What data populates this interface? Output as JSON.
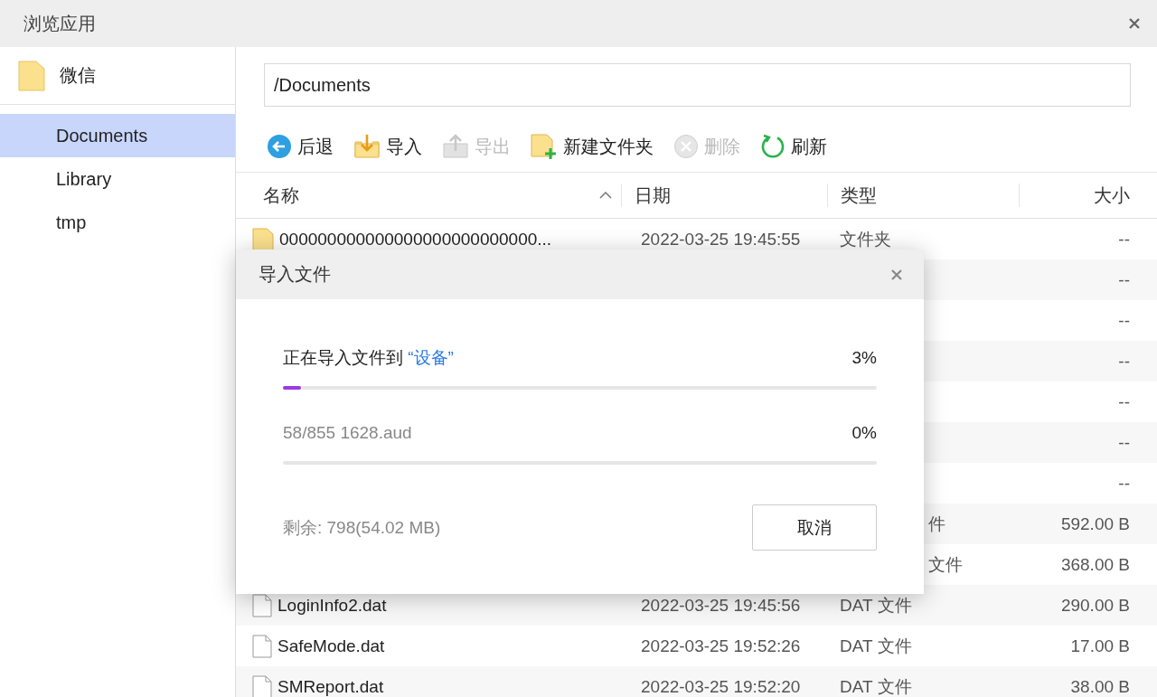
{
  "window": {
    "title": "浏览应用"
  },
  "sidebar": {
    "app": {
      "label": "微信"
    },
    "items": [
      {
        "label": "Documents",
        "selected": true
      },
      {
        "label": "Library",
        "selected": false
      },
      {
        "label": "tmp",
        "selected": false
      }
    ]
  },
  "path_field": {
    "value": "/Documents"
  },
  "toolbar": [
    {
      "kind": "back",
      "label": "后退",
      "disabled": false
    },
    {
      "kind": "import",
      "label": "导入",
      "disabled": false
    },
    {
      "kind": "export",
      "label": "导出",
      "disabled": true
    },
    {
      "kind": "new-folder",
      "label": "新建文件夹",
      "disabled": false
    },
    {
      "kind": "delete",
      "label": "删除",
      "disabled": true
    },
    {
      "kind": "refresh",
      "label": "刷新",
      "disabled": false
    }
  ],
  "table": {
    "columns": [
      {
        "label": "名称",
        "sorted": true
      },
      {
        "label": "日期",
        "sorted": false
      },
      {
        "label": "类型",
        "sorted": false
      },
      {
        "label": "大小",
        "sorted": false
      }
    ],
    "rows": [
      {
        "kind": "folder",
        "name": "000000000000000000000000000...",
        "date": "2022-03-25 19:45:55",
        "type": "文件夹",
        "size": "--"
      },
      {
        "kind": "covered",
        "size": "--"
      },
      {
        "kind": "covered",
        "size": "--"
      },
      {
        "kind": "covered",
        "size": "--"
      },
      {
        "kind": "covered",
        "size": "--"
      },
      {
        "kind": "covered",
        "size": "--"
      },
      {
        "kind": "covered",
        "size": "--"
      },
      {
        "kind": "covered",
        "type": "件",
        "size": "592.00 B"
      },
      {
        "kind": "covered",
        "type": "文件",
        "size": "368.00 B"
      },
      {
        "kind": "file",
        "name": "LoginInfo2.dat",
        "date": "2022-03-25 19:45:56",
        "type": "DAT 文件",
        "size": "290.00 B"
      },
      {
        "kind": "file",
        "name": "SafeMode.dat",
        "date": "2022-03-25 19:52:26",
        "type": "DAT 文件",
        "size": "17.00 B"
      },
      {
        "kind": "file",
        "name": "SMReport.dat",
        "date": "2022-03-25 19:52:20",
        "type": "DAT 文件",
        "size": "38.00 B"
      }
    ]
  },
  "dialog": {
    "title": "导入文件",
    "overall": {
      "label": "正在导入文件到",
      "target": "“设备”",
      "percent": "3%",
      "level": 0.03
    },
    "current": {
      "label": "58/855 1628.aud",
      "percent": "0%"
    },
    "remaining": "剩余: 798(54.02 MB)",
    "cancel": "取消"
  }
}
